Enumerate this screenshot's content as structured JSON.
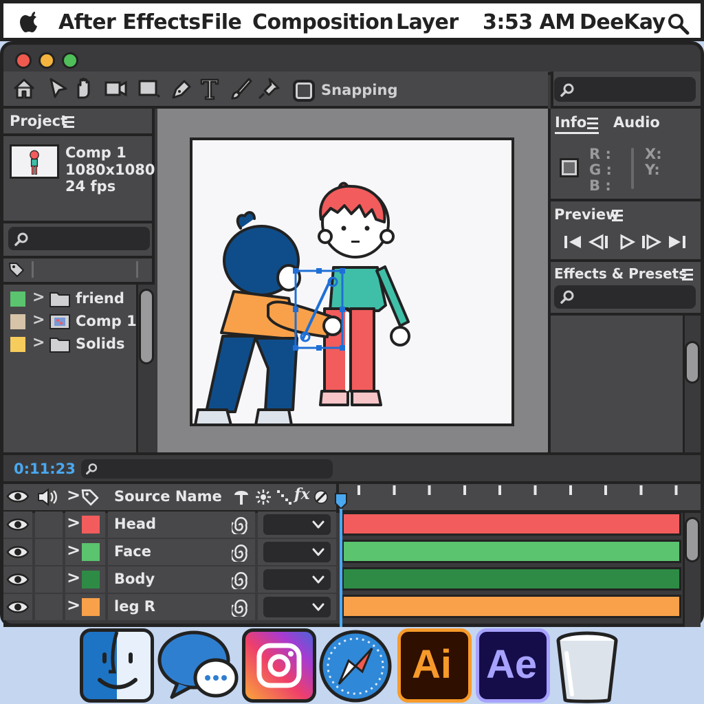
{
  "menubar": {
    "app_name": "After Effects",
    "items": [
      "File",
      "Composition",
      "Layer"
    ],
    "clock": "3:53 AM",
    "user": "DeeKay"
  },
  "toolbar": {
    "snapping_label": "Snapping",
    "tools": [
      "home-icon",
      "selection-arrow-icon",
      "hand-icon",
      "camera-icon",
      "rectangle-icon",
      "pen-icon",
      "type-icon",
      "brush-icon",
      "puppet-pin-icon"
    ]
  },
  "project": {
    "title": "Project",
    "comp_name": "Comp 1",
    "comp_size": "1080x1080",
    "comp_fps": "24 fps",
    "items": [
      {
        "name": "friend",
        "color": "#5bc46e",
        "type": "folder"
      },
      {
        "name": "Comp 1",
        "color": "#d6c3a8",
        "type": "composition"
      },
      {
        "name": "Solids",
        "color": "#f6cc5c",
        "type": "folder"
      }
    ]
  },
  "info": {
    "tab_info": "Info",
    "tab_audio": "Audio",
    "r": "R :",
    "g": "G :",
    "b": "B :",
    "x": "X:",
    "y": "Y:"
  },
  "preview": {
    "title": "Preview"
  },
  "effects": {
    "title": "Effects & Presets"
  },
  "timeline": {
    "timecode": "0:11:23",
    "source_name_header": "Source Name",
    "layers": [
      {
        "name": "Head",
        "color": "#f25c5c"
      },
      {
        "name": "Face",
        "color": "#5bc46e"
      },
      {
        "name": "Body",
        "color": "#2e8b45"
      },
      {
        "name": "leg R",
        "color": "#f8a14a"
      }
    ]
  },
  "dock": [
    "finder-icon",
    "messages-icon",
    "instagram-icon",
    "safari-icon",
    "illustrator-icon",
    "after-effects-icon",
    "trash-icon"
  ],
  "dock_labels": {
    "ai": "Ai",
    "ae": "Ae"
  }
}
